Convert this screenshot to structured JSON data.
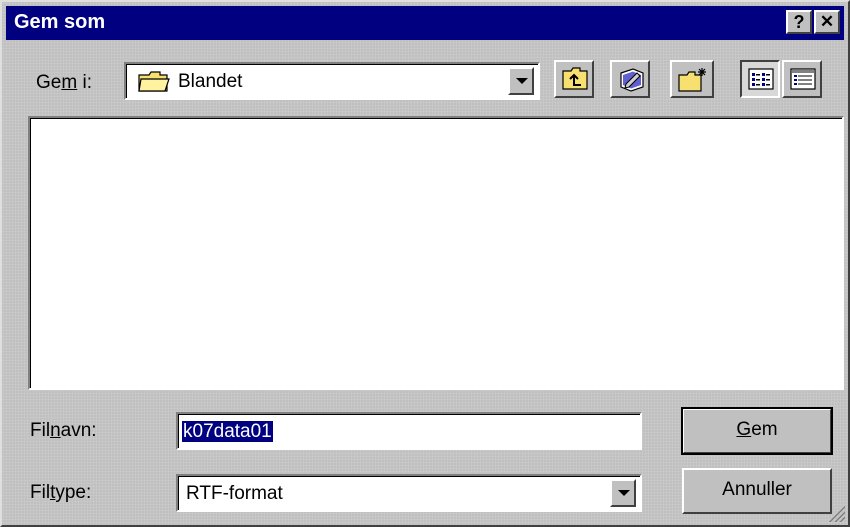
{
  "window": {
    "title": "Gem som",
    "help_button": "?",
    "close_button": "✕"
  },
  "save_in": {
    "label_pre": "Ge",
    "label_mnemonic": "m",
    "label_post": " i:",
    "value": "Blandet",
    "folder_icon": "folder-icon"
  },
  "toolbar": {
    "buttons": [
      {
        "name": "up-one-level-button",
        "icon": "up-folder-icon"
      },
      {
        "name": "desktop-button",
        "icon": "desktop-icon"
      },
      {
        "name": "new-folder-button",
        "icon": "new-folder-icon"
      },
      {
        "name": "list-view-button",
        "icon": "list-view-icon",
        "pressed": true
      },
      {
        "name": "details-view-button",
        "icon": "details-view-icon"
      }
    ]
  },
  "file_list": {
    "items": []
  },
  "filename": {
    "label_pre": "Fil",
    "label_mnemonic": "n",
    "label_post": "avn:",
    "value": "k07data01"
  },
  "filetype": {
    "label_pre": "Fil",
    "label_mnemonic": "t",
    "label_post": "ype:",
    "value": "RTF-format"
  },
  "buttons": {
    "save_mnemonic": "G",
    "save_rest": "em",
    "cancel_label": "Annuller"
  },
  "colors": {
    "titlebar": "#000080",
    "face": "#c0c0c0",
    "selection": "#000080"
  }
}
